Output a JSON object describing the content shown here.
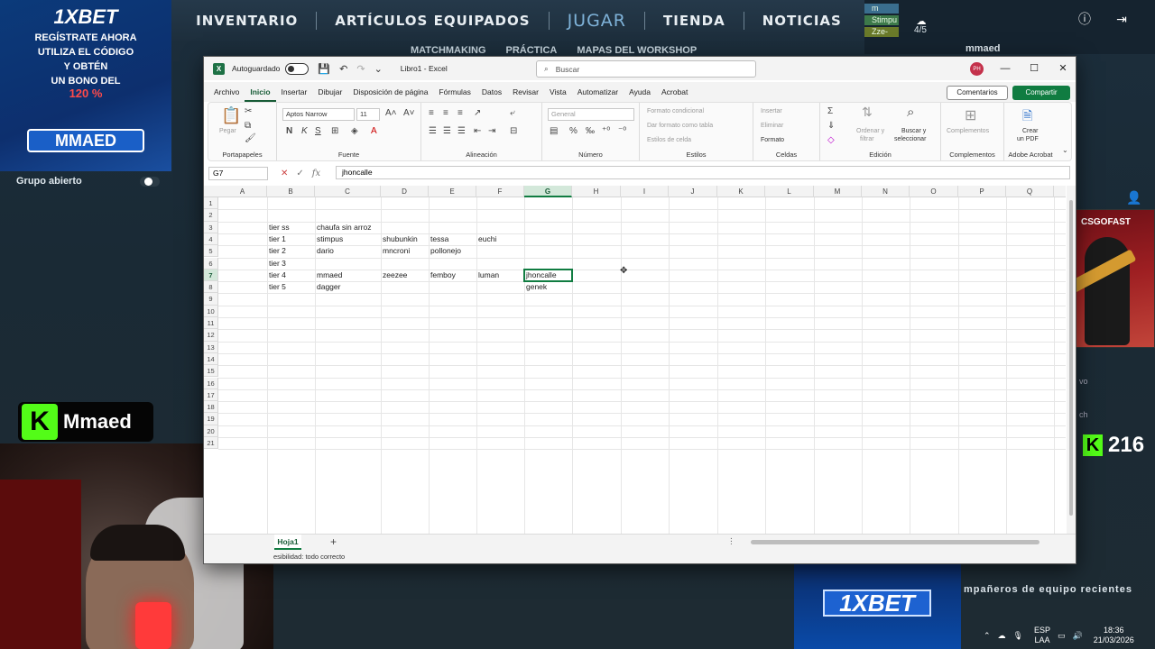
{
  "game": {
    "nav": [
      "INVENTARIO",
      "ARTÍCULOS EQUIPADOS",
      "JUGAR",
      "TIENDA",
      "NOTICIAS"
    ],
    "subnav": [
      "MATCHMAKING",
      "PRÁCTICA",
      "MAPAS DEL WORKSHOP"
    ],
    "mini_tags": [
      "m",
      "Stimpu",
      "Zze-"
    ],
    "party_count": "4/5",
    "username": "mmaed",
    "group_label": "Grupo abierto",
    "teammates_label": "mpañeros de equipo recientes",
    "side_text_1": "vo",
    "side_text_2": "ch"
  },
  "overlays": {
    "ad_top": {
      "brand": "1XBET",
      "line1": "REGÍSTRATE AHORA",
      "line2": "UTILIZA EL CÓDIGO",
      "line3": "Y OBTÉN",
      "line4": "UN BONO DEL",
      "promo": "120 %",
      "code": "MMAED"
    },
    "kick_name": "Mmaed",
    "kick_letter": "K",
    "viewer_count": "216",
    "csgofast_brand": "CSGOFAST",
    "ad_bottom_brand": "1XBET"
  },
  "tray": {
    "lang": "ESP",
    "layout": "LAA",
    "time": "18:36",
    "date": "21/03/2026"
  },
  "excel": {
    "title": {
      "autosave": "Autoguardado",
      "doc": "Libro1  -  Excel",
      "search_placeholder": "Buscar",
      "avatar": "PH"
    },
    "menu": [
      "Archivo",
      "Inicio",
      "Insertar",
      "Dibujar",
      "Disposición de página",
      "Fórmulas",
      "Datos",
      "Revisar",
      "Vista",
      "Automatizar",
      "Ayuda",
      "Acrobat"
    ],
    "comments_btn": "Comentarios",
    "share_btn": "Compartir",
    "ribbon": {
      "groups": [
        "Portapapeles",
        "Fuente",
        "Alineación",
        "Número",
        "Estilos",
        "Celdas",
        "Edición",
        "Complementos",
        "Adobe Acrobat"
      ],
      "paste": "Pegar",
      "font_name": "Aptos Narrow",
      "font_size": "11",
      "number_format": "General",
      "cond_format": "Formato condicional",
      "table_format": "Dar formato como tabla",
      "cell_styles": "Estilos de celda",
      "insert": "Insertar",
      "delete": "Eliminar",
      "format": "Formato",
      "sort_filter_1": "Ordenar y",
      "sort_filter_2": "filtrar",
      "find_1": "Buscar y",
      "find_2": "seleccionar",
      "addins": "Complementos",
      "pdf_1": "Crear",
      "pdf_2": "un PDF"
    },
    "name_box": "G7",
    "formula": "jhoncalle",
    "columns": [
      "A",
      "B",
      "C",
      "D",
      "E",
      "F",
      "G",
      "H",
      "I",
      "J",
      "K",
      "L",
      "M",
      "N",
      "O",
      "P",
      "Q"
    ],
    "rows": [
      "1",
      "2",
      "3",
      "4",
      "5",
      "6",
      "7",
      "8",
      "9",
      "10",
      "11",
      "12",
      "13",
      "14",
      "15",
      "16",
      "17",
      "18",
      "19",
      "20",
      "21"
    ],
    "cells": {
      "B3": "tier ss",
      "C3": "chaufa sin arroz",
      "B4": "tier 1",
      "C4": "stimpus",
      "D4": "shubunkin",
      "E4": "tessa",
      "F4": "euchi",
      "B5": "tier 2",
      "C5": "dario",
      "D5": "mncroni",
      "E5": "pollonejo",
      "B6": "tier 3",
      "B7": "tier 4",
      "C7": "mmaed",
      "D7": "zeezee",
      "E7": "femboy",
      "F7": "luman",
      "G7": "jhoncalle",
      "B8": "tier 5",
      "C8": "dagger",
      "G8": "genek"
    },
    "sheet_tab": "Hoja1",
    "status": "esibilidad: todo correcto"
  }
}
